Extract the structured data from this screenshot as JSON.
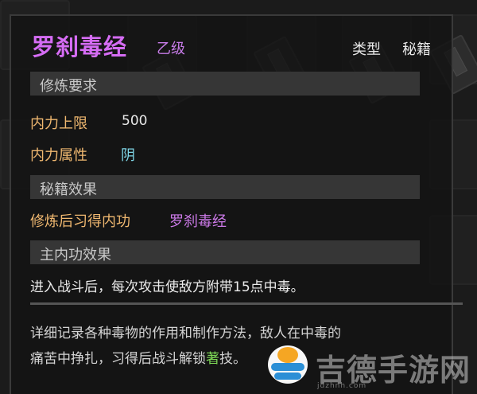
{
  "item": {
    "name": "罗刹毒经",
    "grade": "乙级",
    "type_label": "类型",
    "type_value": "秘籍"
  },
  "sections": {
    "requirement_header": "修炼要求",
    "effect_header": "秘籍效果",
    "main_effect_header": "主内功效果"
  },
  "requirements": [
    {
      "label": "内力上限",
      "value": "500"
    },
    {
      "label": "内力属性",
      "value": "阴"
    }
  ],
  "learn": {
    "label": "修炼后习得内功",
    "value": "罗刹毒经"
  },
  "main_effect_text": "进入战斗后，每次攻击使敌方附带15点中毒。",
  "flavor": {
    "line1": "详细记录各种毒物的作用和制作方法，敌人在中毒的",
    "line2_a": "痛苦中挣扎，习得后战斗解锁",
    "line2_b": "著",
    "line2_c": "技。"
  },
  "watermark": {
    "text": "吉德手游网",
    "url": "jdzhnh.com"
  },
  "colors": {
    "title": "#d56cf4",
    "attr_label": "#f0b870",
    "yin": "#7fd6e6",
    "skill": "#cc7ae8"
  }
}
